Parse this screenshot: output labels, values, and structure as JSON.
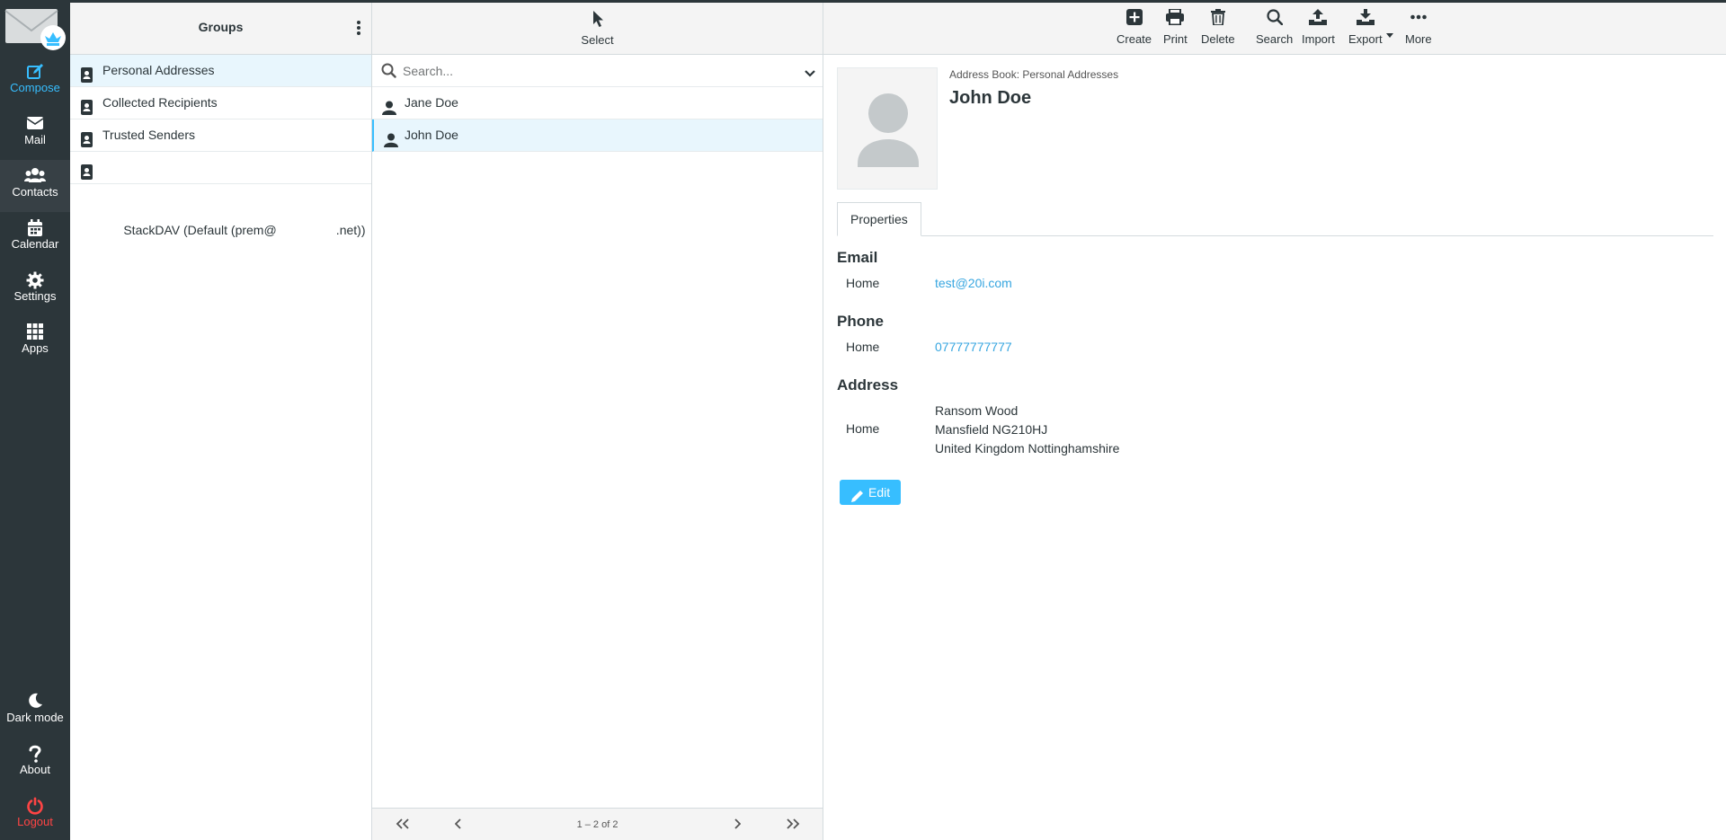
{
  "nav": {
    "compose": "Compose",
    "mail": "Mail",
    "contacts": "Contacts",
    "calendar": "Calendar",
    "settings": "Settings",
    "apps": "Apps",
    "dark_mode": "Dark mode",
    "about": "About",
    "logout": "Logout"
  },
  "groups": {
    "title": "Groups",
    "items": [
      {
        "label": "Personal Addresses"
      },
      {
        "label": "Collected Recipients"
      },
      {
        "label": "Trusted Senders"
      },
      {
        "label": "StackDAV (Default (prem@                 .net))"
      }
    ]
  },
  "list": {
    "select_label": "Select",
    "search_placeholder": "Search...",
    "contacts": [
      {
        "name": "Jane Doe"
      },
      {
        "name": "John Doe"
      }
    ],
    "count": "1 – 2 of 2"
  },
  "toolbar": {
    "create": "Create",
    "print": "Print",
    "delete": "Delete",
    "search": "Search",
    "import": "Import",
    "export": "Export",
    "more": "More"
  },
  "contact": {
    "address_book": "Address Book: Personal Addresses",
    "name": "John Doe",
    "tab": "Properties",
    "email_title": "Email",
    "email_label": "Home",
    "email_value": "test@20i.com",
    "phone_title": "Phone",
    "phone_label": "Home",
    "phone_value": "07777777777",
    "address_title": "Address",
    "address_label": "Home",
    "address_line1": "Ransom Wood",
    "address_line2": "Mansfield NG210HJ",
    "address_line3": "United Kingdom Nottinghamshire",
    "edit_label": "Edit"
  },
  "colors": {
    "nav_bg": "#2c363a",
    "accent": "#37beff",
    "logout": "#ff4444",
    "selected_row": "#e8f6fd"
  }
}
